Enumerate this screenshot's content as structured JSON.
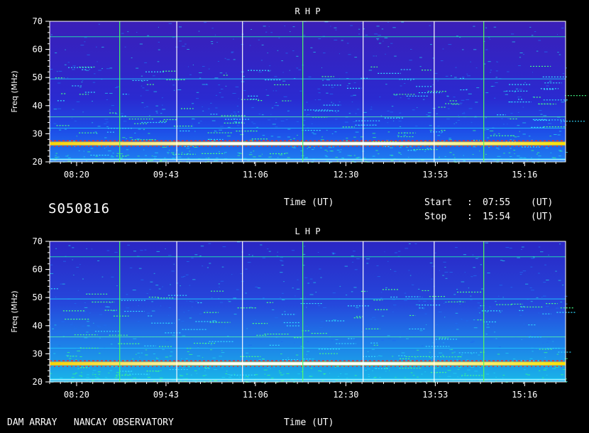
{
  "colors": {
    "background": "#000000",
    "plot_bg": "#2a22c0",
    "axis": "#ffffff"
  },
  "header": {
    "station_id": "S050816",
    "time_label": "Time (UT)",
    "start_label": "Start",
    "start_sep": ":",
    "start_value": "07:55",
    "start_unit": "(UT)",
    "stop_label": "Stop",
    "stop_sep": ":",
    "stop_value": "15:54",
    "stop_unit": "(UT)"
  },
  "footer": {
    "observatory": "DAM ARRAY   NANCAY OBSERVATORY",
    "time_label": "Time (UT)"
  },
  "chart_data": [
    {
      "type": "heatmap",
      "title": "R H P",
      "ylabel": "Freq (MHz)",
      "ylim": [
        20,
        70
      ],
      "yticks": [
        "20",
        "30",
        "40",
        "50",
        "60",
        "70"
      ],
      "xticks": [
        "08:20",
        "09:43",
        "11:06",
        "12:30",
        "13:53",
        "15:16"
      ],
      "bright_band_mhz": [
        26,
        27
      ],
      "interference_lines_mhz": [
        21,
        26.5,
        32,
        36,
        49.5,
        64.5
      ],
      "vertical_markers_time": [
        "09:00",
        "09:53",
        "10:54",
        "11:50",
        "12:46",
        "13:52",
        "14:38"
      ]
    },
    {
      "type": "heatmap",
      "title": "L H P",
      "ylabel": "Freq (MHz)",
      "ylim": [
        20,
        70
      ],
      "yticks": [
        "20",
        "30",
        "40",
        "50",
        "60",
        "70"
      ],
      "xticks": [
        "08:20",
        "09:43",
        "11:06",
        "12:30",
        "13:53",
        "15:16"
      ],
      "bright_band_mhz": [
        26,
        27
      ],
      "interference_lines_mhz": [
        21,
        26.5,
        32,
        36,
        49.5,
        64.5
      ],
      "vertical_markers_time": [
        "09:00",
        "09:53",
        "10:54",
        "11:50",
        "12:46",
        "13:52",
        "14:38"
      ]
    }
  ]
}
